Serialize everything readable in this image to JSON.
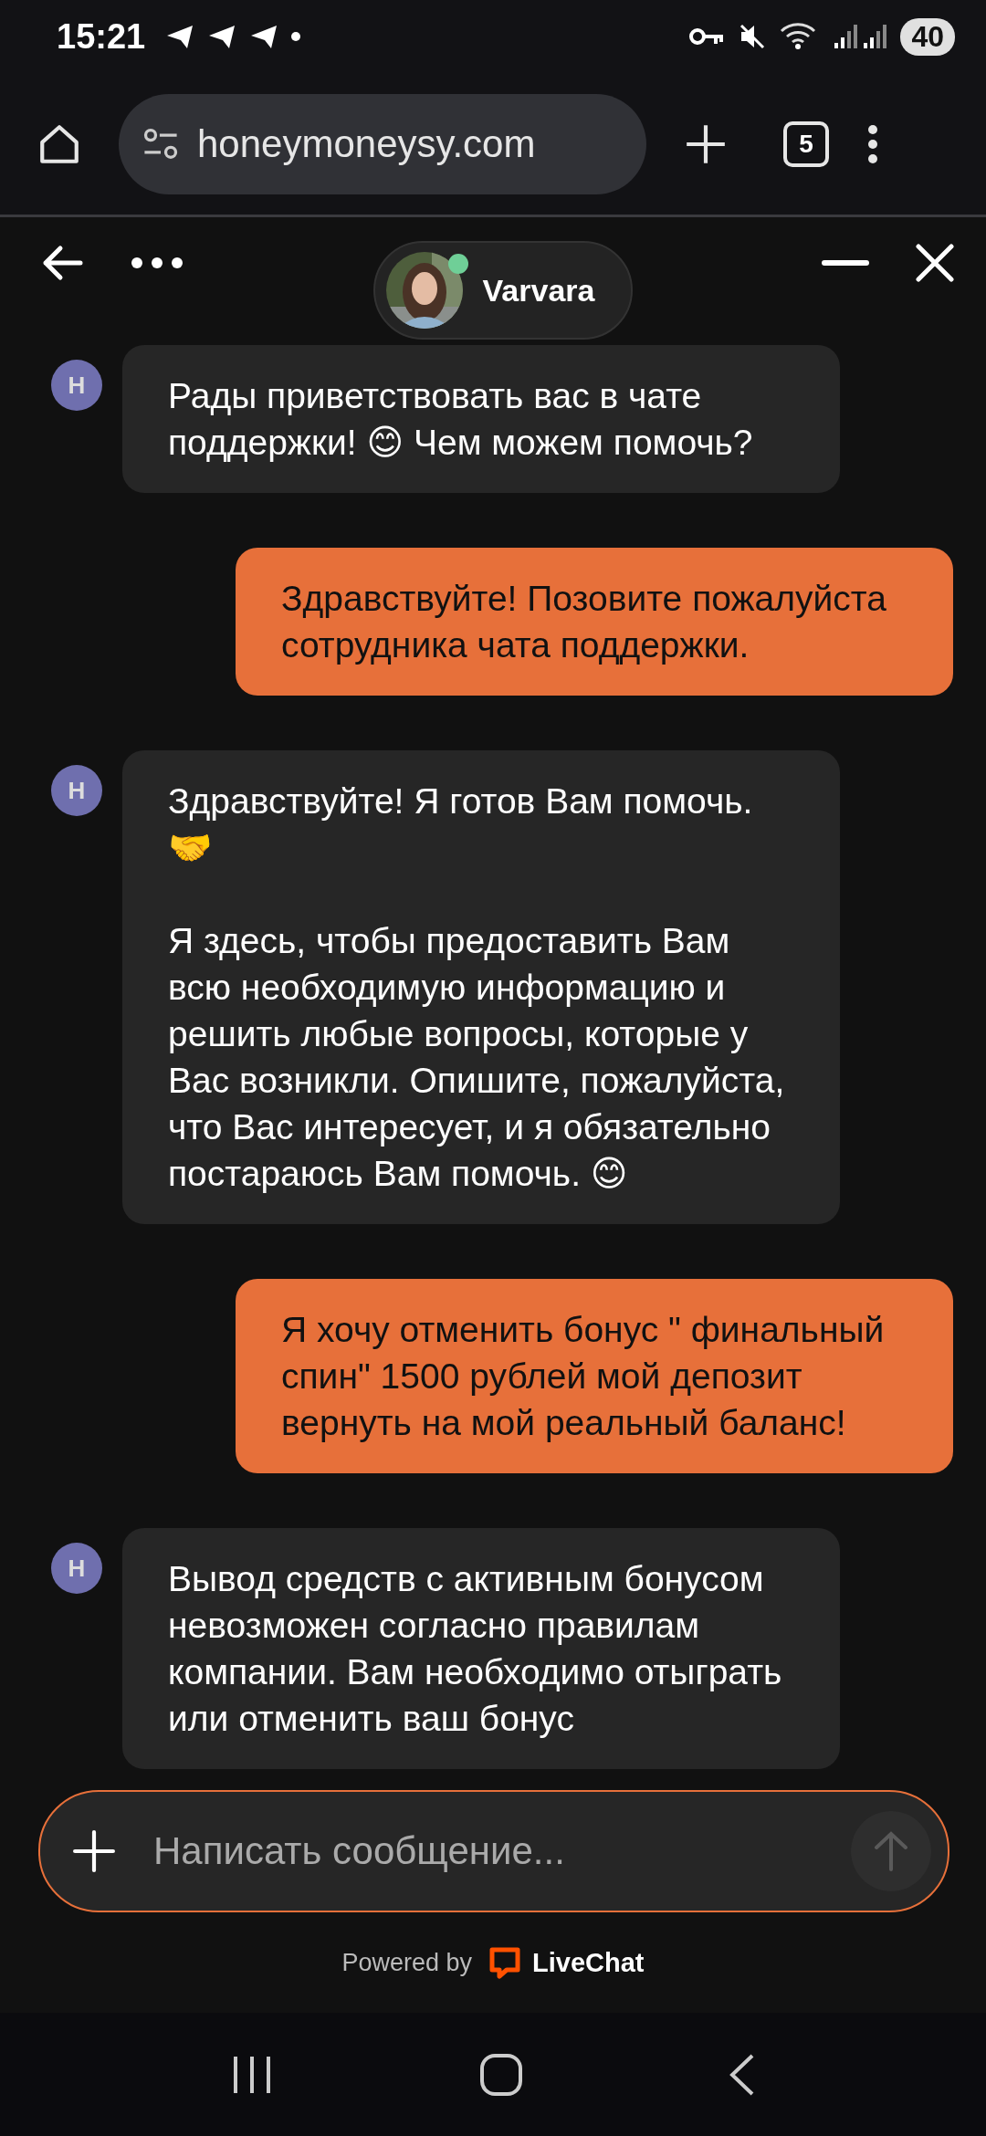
{
  "status_bar": {
    "time": "15:21",
    "battery": "40"
  },
  "browser": {
    "url": "honeymoneysy.com",
    "tab_count": "5"
  },
  "chat_header": {
    "agent_name": "Varvara",
    "online": true
  },
  "messages": [
    {
      "kind": "agent",
      "avatar": "H",
      "paragraphs": [
        "Рады приветствовать вас в чате поддержки! 😊 Чем можем помочь?"
      ]
    },
    {
      "kind": "user",
      "paragraphs": [
        "Здравствуйте! Позовите пожалуйста сотрудника чата поддержки."
      ]
    },
    {
      "kind": "agent",
      "avatar": "H",
      "paragraphs": [
        "Здравствуйте! Я готов Вам помочь. 🤝",
        "Я здесь, чтобы предоставить Вам всю необходимую информацию и решить любые вопросы, которые у Вас возникли. Опишите, пожалуйста, что Вас интересует, и я обязательно постараюсь Вам помочь. 😊"
      ]
    },
    {
      "kind": "user",
      "paragraphs": [
        "Я хочу отменить бонус \" финальный спин\" 1500 рублей мой депозит вернуть на мой реальный баланс!"
      ]
    },
    {
      "kind": "agent",
      "avatar": "H",
      "paragraphs": [
        "Вывод средств с активным бонусом невозможен согласно правилам компании. Вам необходимо отыграть или отменить ваш бонус"
      ]
    }
  ],
  "composer": {
    "placeholder": "Написать сообщение..."
  },
  "footer": {
    "powered_by": "Powered by",
    "brand": "LiveChat"
  }
}
